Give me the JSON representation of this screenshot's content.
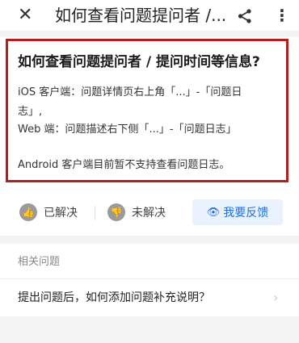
{
  "header": {
    "close_icon": "close-icon",
    "title": "如何查看问题提问者 /...",
    "share_icon": "share-icon",
    "more_icon": "more-vert-icon"
  },
  "article": {
    "heading": "如何查看问题提问者 / 提问时间等信息?",
    "lines": [
      "iOS 客户端：问题详情页右上角「...」-「问题日",
      "志」,",
      "Web 端：问题描述右下侧「...」-「问题日志」",
      "Android 客户端目前暂不支持查看问题日志。"
    ],
    "highlight_color": "#b21f1f"
  },
  "actions": {
    "solved_label": "已解决",
    "unsolved_label": "未解决",
    "feedback_label": "我要反馈",
    "feedback_color": "#1f6fe0"
  },
  "related": {
    "heading": "相关问题",
    "items": [
      "提出问题后，如何添加问题补充说明？"
    ]
  }
}
